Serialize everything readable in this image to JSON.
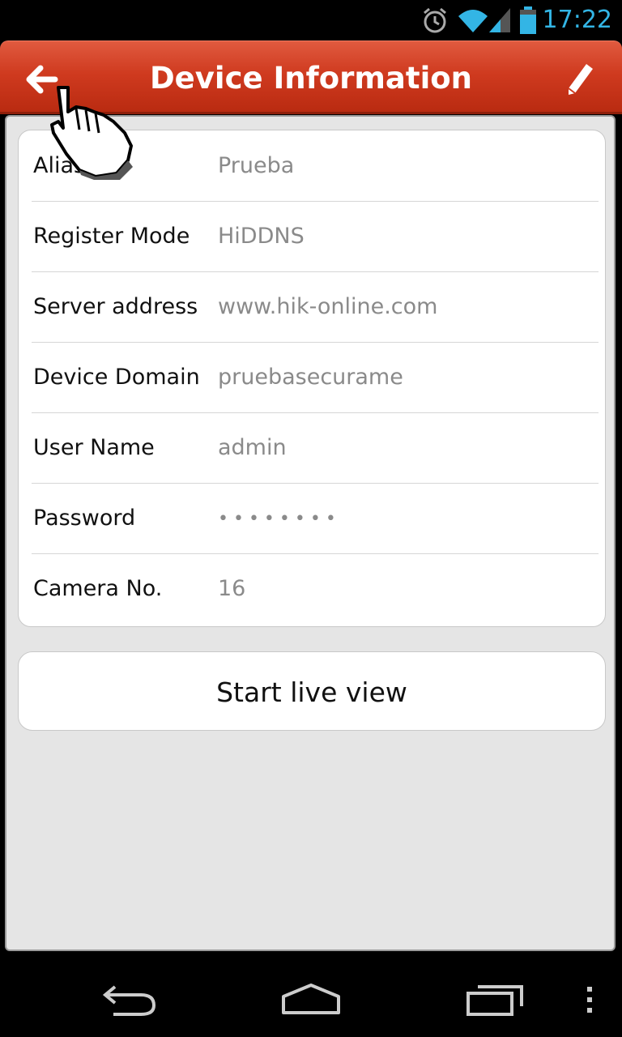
{
  "status_bar": {
    "time": "17:22",
    "icons": [
      "alarm-icon",
      "wifi-icon",
      "signal-icon",
      "battery-icon"
    ],
    "accent_color": "#33b5e5"
  },
  "header": {
    "title": "Device Information",
    "back_icon": "back-arrow-icon",
    "edit_icon": "pencil-icon",
    "color": "#cf3a1f"
  },
  "device_info": {
    "rows": [
      {
        "label": "Alias",
        "value": "Prueba"
      },
      {
        "label": "Register Mode",
        "value": "HiDDNS"
      },
      {
        "label": "Server address",
        "value": "www.hik-online.com"
      },
      {
        "label": "Device Domain",
        "value": "pruebasecurame"
      },
      {
        "label": "User Name",
        "value": "admin"
      },
      {
        "label": "Password",
        "value": "••••••••"
      },
      {
        "label": "Camera No.",
        "value": "16"
      }
    ]
  },
  "actions": {
    "start_live_view": "Start live view"
  },
  "nav_bar": {
    "icons": [
      "back-nav-icon",
      "home-nav-icon",
      "recents-nav-icon",
      "overflow-menu-icon"
    ]
  }
}
